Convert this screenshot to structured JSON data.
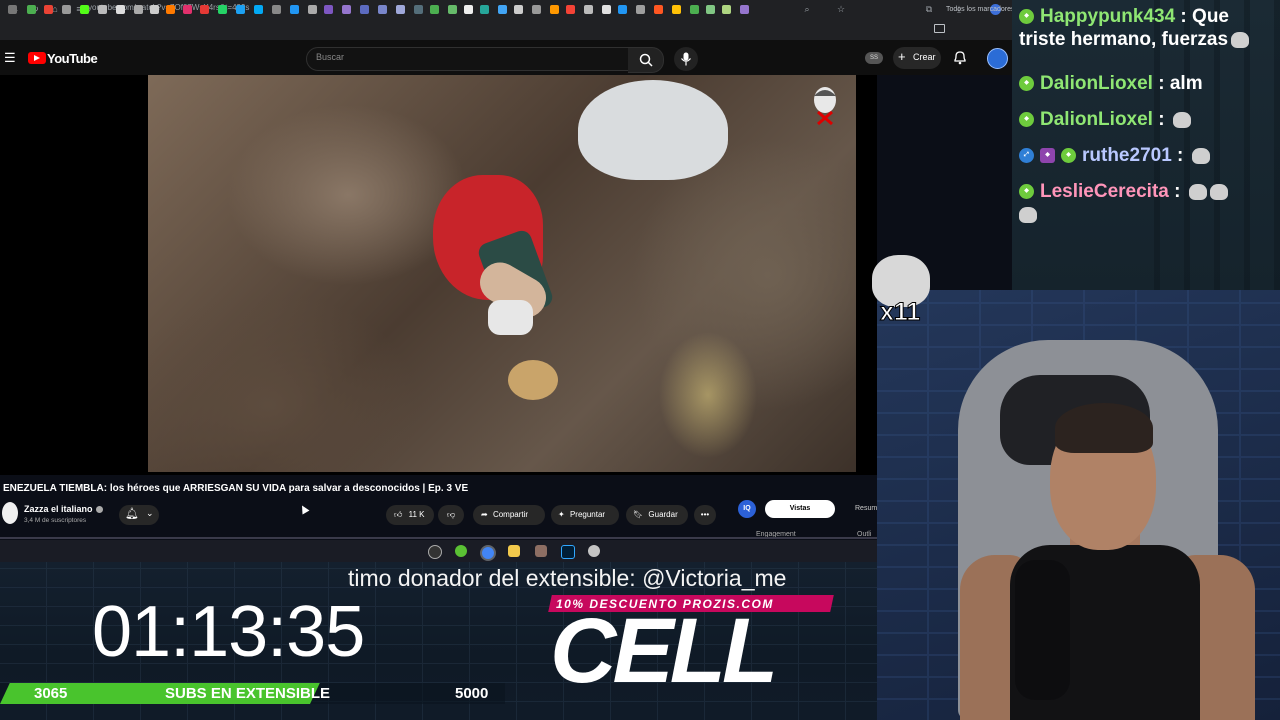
{
  "browser": {
    "url": "youtube.com/watch?v=7Of07WsX4rs&t=499s",
    "bookmarks_folder": "Todos los marcadores"
  },
  "youtube": {
    "logo_text": "YouTube",
    "search_placeholder": "Buscar",
    "ss_badge": "SS",
    "create_label": "Crear"
  },
  "video": {
    "title": "ENEZUELA TIEMBLA: los héroes que ARRIESGAN SU VIDA para salvar a desconocidos | Ep. 3 VE",
    "channel_name": "Zazza el italiano",
    "channel_subs": "3,4 M de suscriptores",
    "likes": "11 K",
    "share_label": "Compartir",
    "ask_label": "Preguntar",
    "save_label": "Guardar",
    "panel_iq": "IQ",
    "panel_tab_active": "Vistas",
    "panel_tab_other": "Resum",
    "panel_engagement": "Engagement",
    "panel_outline": "Outli"
  },
  "overlay": {
    "donor_text": "timo donador del extensible: @Victoria_me",
    "promo": "10% DESCUENTO PROZIS.COM",
    "logo": "CELL",
    "timer": "01:13:35",
    "subs_current": "3065",
    "subs_label": "SUBS EN EXTENSIBLE",
    "subs_goal": "5000",
    "subs_progress": 0.613
  },
  "chat": {
    "messages": [
      {
        "user": "Happypunk434",
        "text": "Que triste hermano, fuerzas"
      },
      {
        "user": "DalionLioxel",
        "text": "alm"
      },
      {
        "user": "DalionLioxel",
        "text": ""
      },
      {
        "user": "ruthe2701",
        "text": ""
      },
      {
        "user": "LeslieCerecita",
        "text": ""
      }
    ],
    "emote_multiplier": "x11"
  },
  "colors": {
    "youtube_red": "#ff0000",
    "progress_green": "#49c42d",
    "promo_pink": "#c7085d",
    "chat_user_green": "#8fe673",
    "chat_user_pink": "#ff95b9"
  }
}
